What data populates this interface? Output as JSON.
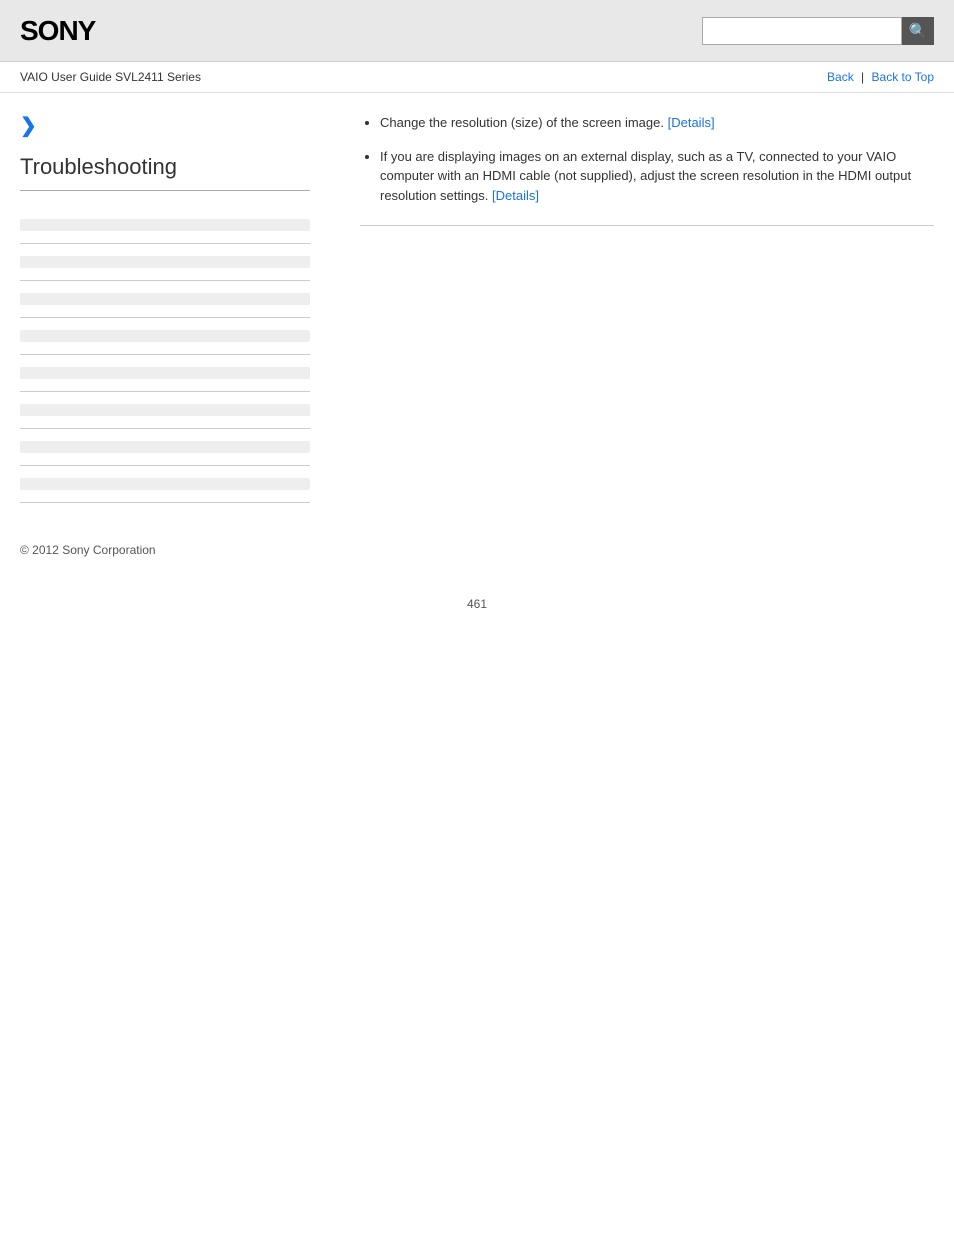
{
  "header": {
    "logo": "SONY",
    "search_placeholder": "",
    "search_button_icon": "🔍"
  },
  "nav": {
    "breadcrumb": "VAIO User Guide SVL2411 Series",
    "back_link": "Back",
    "back_to_top_link": "Back to Top",
    "separator": "|"
  },
  "sidebar": {
    "chevron": "❯",
    "title": "Troubleshooting",
    "links": [
      {
        "label": ""
      },
      {
        "label": ""
      },
      {
        "label": ""
      },
      {
        "label": ""
      },
      {
        "label": ""
      },
      {
        "label": ""
      },
      {
        "label": ""
      },
      {
        "label": ""
      }
    ]
  },
  "content": {
    "items": [
      {
        "text": "Change the resolution (size) of the screen image.",
        "link_text": "[Details]"
      },
      {
        "text": "If you are displaying images on an external display, such as a TV, connected to your VAIO computer with an HDMI cable (not supplied), adjust the screen resolution in the HDMI output resolution settings.",
        "link_text": "[Details]"
      }
    ]
  },
  "footer": {
    "copyright": "© 2012 Sony Corporation"
  },
  "page_number": "461"
}
